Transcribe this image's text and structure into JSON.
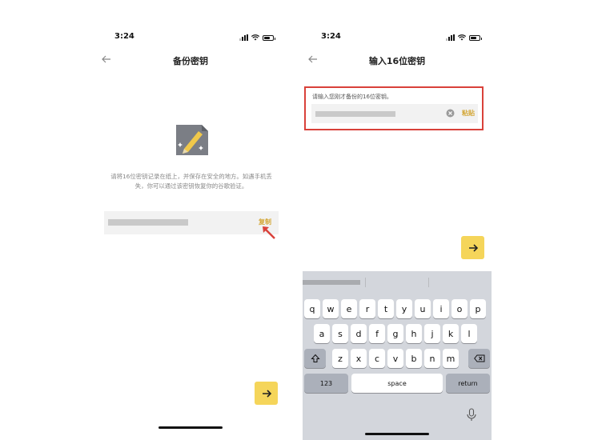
{
  "left_screen": {
    "status_time": "3:24",
    "title": "备份密钥",
    "tip": "请将16位密钥记录在纸上，并保存在安全的地方。如遇手机丢失，你可以通过该密钥恢复你的谷歌验证。",
    "copy_label": "复制"
  },
  "right_screen": {
    "status_time": "3:24",
    "title": "输入16位密钥",
    "input_label": "请输入您刚才备份的16位密钥。",
    "paste_label": "粘贴"
  },
  "keyboard": {
    "row1": [
      "q",
      "w",
      "e",
      "r",
      "t",
      "y",
      "u",
      "i",
      "o",
      "p"
    ],
    "row2": [
      "a",
      "s",
      "d",
      "f",
      "g",
      "h",
      "j",
      "k",
      "l"
    ],
    "row3": [
      "z",
      "x",
      "c",
      "v",
      "b",
      "n",
      "m"
    ],
    "numbers_label": "123",
    "space_label": "space",
    "return_label": "return"
  },
  "colors": {
    "accent_yellow": "#f5d55a",
    "link_gold": "#d4a83a",
    "highlight_red": "#d9413a"
  }
}
